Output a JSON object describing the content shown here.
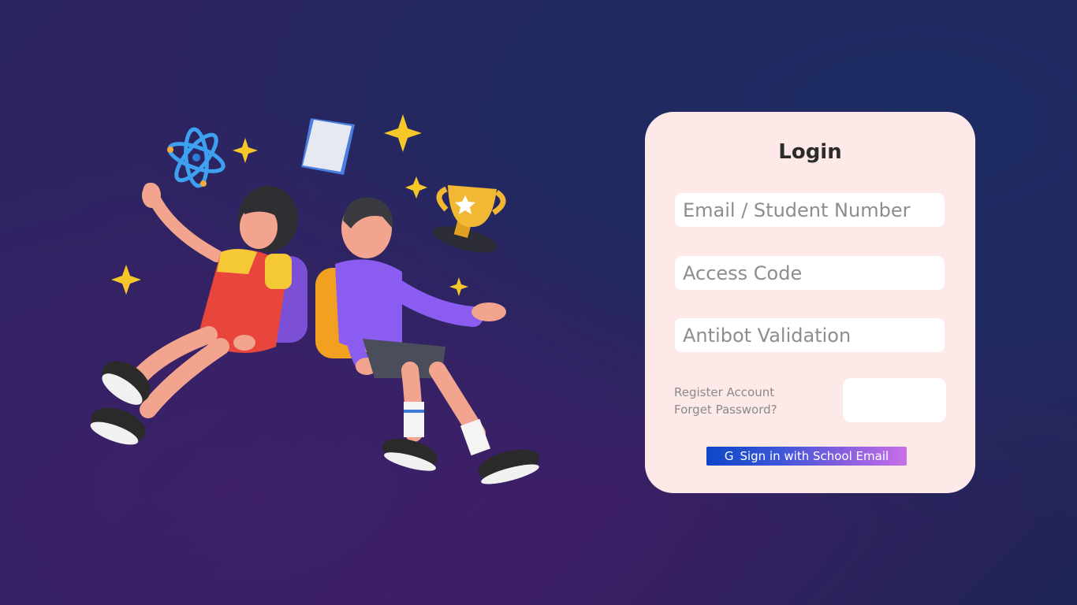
{
  "login": {
    "title": "Login",
    "fields": {
      "email_placeholder": "Email / Student Number",
      "code_placeholder": "Access Code",
      "antibot_placeholder": "Antibot Validation"
    },
    "links": {
      "register": "Register Account",
      "forgot": "Forget Password?"
    },
    "school_button": {
      "icon": "G",
      "label": "Sign in with School Email"
    }
  },
  "colors": {
    "card_bg": "#fde9e8",
    "button_gradient_start": "#0d46c7",
    "button_gradient_end": "#c86fe6",
    "background_dark": "#2b2560"
  },
  "illustration": {
    "icons": [
      "atom-icon",
      "book-icon",
      "trophy-icon",
      "sparkle-icon"
    ]
  }
}
